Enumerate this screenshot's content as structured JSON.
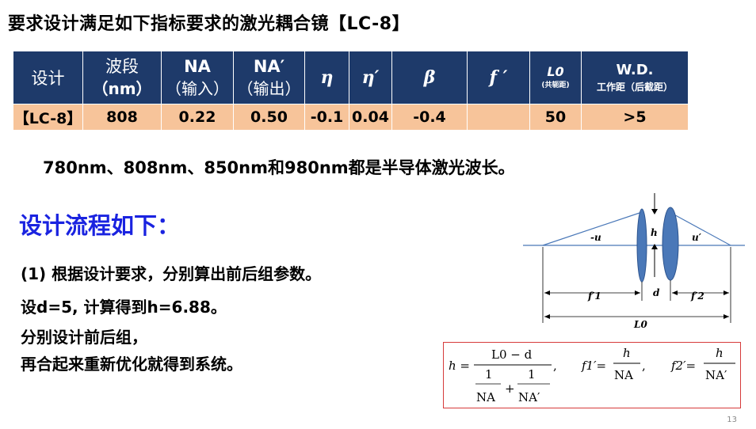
{
  "title": "要求设计满足如下指标要求的激光耦合镜【LC-8】",
  "table": {
    "header": {
      "design": "设计",
      "band_1": "波段",
      "band_2": "（nm）",
      "na_in_1": "NA",
      "na_in_2": "（输入）",
      "na_out_1": "NA′",
      "na_out_2": "（输出）",
      "eta": "η",
      "eta_prime": "η′",
      "beta": "β",
      "f_prime": "f ′",
      "l0_1": "L0",
      "l0_2": "(共轭距)",
      "wd_1": "W.D.",
      "wd_2": "工作距（后截距）"
    },
    "row": {
      "design": "【LC-8】",
      "band": "808",
      "na_in": "0.22",
      "na_out": "0.50",
      "eta": "-0.1",
      "eta_prime": "0.04",
      "beta": "-0.4",
      "f_prime": "",
      "l0": "50",
      "wd": ">5"
    }
  },
  "note": "780nm、808nm、850nm和980nm都是半导体激光波长。",
  "flow": {
    "title": "设计流程如下：",
    "step1": "(1) 根据设计要求，分别算出前后组参数。",
    "step2": "设d=5, 计算得到h=6.88。",
    "step3": "分别设计前后组，",
    "step4": "再合起来重新优化就得到系统。"
  },
  "diagram": {
    "label_u": "-u",
    "label_h": "h",
    "label_u_prime": "u′",
    "label_f1": "f′1",
    "label_d": "d",
    "label_f2": "f′2",
    "label_L0": "L0"
  },
  "formula": {
    "h_eq": "h =",
    "num": "L0 − d",
    "den1_num": "1",
    "den1_den": "NA",
    "plus": "+",
    "den2_num": "1",
    "den2_den": "NA′",
    "comma1": ",",
    "f1_eq": "f1′=",
    "f1_num": "h",
    "f1_den": "NA",
    "comma2": ",",
    "f2_eq": "f2′=",
    "f2_num": "h",
    "f2_den": "NA′"
  },
  "page_number": "13",
  "colors": {
    "header_bg": "#1e3a6a",
    "row_bg": "#f7c49a",
    "flow_title": "#1a23e0",
    "lens": "#4a78b8",
    "formula_border": "#d63b3b"
  }
}
